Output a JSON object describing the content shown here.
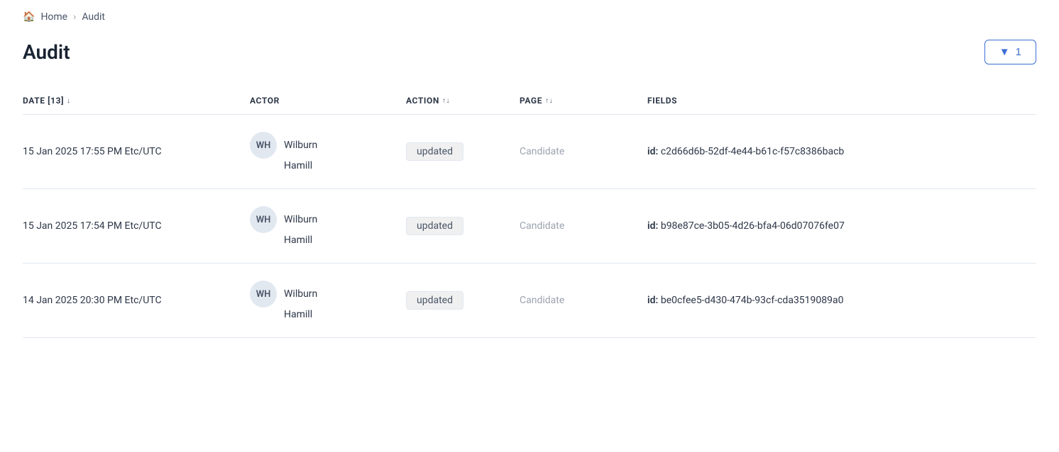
{
  "breadcrumb": {
    "home_label": "Home",
    "current_label": "Audit"
  },
  "page": {
    "title": "Audit"
  },
  "filter_button": {
    "label": "1",
    "icon": "▼"
  },
  "table": {
    "columns": [
      {
        "label": "DATE [13]",
        "sortable": true,
        "sort_icon": "↓"
      },
      {
        "label": "ACTOR",
        "sortable": false
      },
      {
        "label": "ACTION",
        "sortable": true,
        "sort_icon": "↑↓"
      },
      {
        "label": "PAGE",
        "sortable": true,
        "sort_icon": "↑↓"
      },
      {
        "label": "FIELDS",
        "sortable": false
      }
    ],
    "rows": [
      {
        "date": "15 Jan 2025 17:55 PM Etc/UTC",
        "actor_initials": "WH",
        "actor_first": "Wilburn",
        "actor_last": "Hamill",
        "action": "updated",
        "page": "Candidate",
        "fields": "id: c2d66d6b-52df-4e44-b61c-f57c8386bacb"
      },
      {
        "date": "15 Jan 2025 17:54 PM Etc/UTC",
        "actor_initials": "WH",
        "actor_first": "Wilburn",
        "actor_last": "Hamill",
        "action": "updated",
        "page": "Candidate",
        "fields": "id: b98e87ce-3b05-4d26-bfa4-06d07076fe07"
      },
      {
        "date": "14 Jan 2025 20:30 PM Etc/UTC",
        "actor_initials": "WH",
        "actor_first": "Wilburn",
        "actor_last": "Hamill",
        "action": "updated",
        "page": "Candidate",
        "fields": "id: be0cfee5-d430-474b-93cf-cda3519089a0"
      }
    ]
  }
}
